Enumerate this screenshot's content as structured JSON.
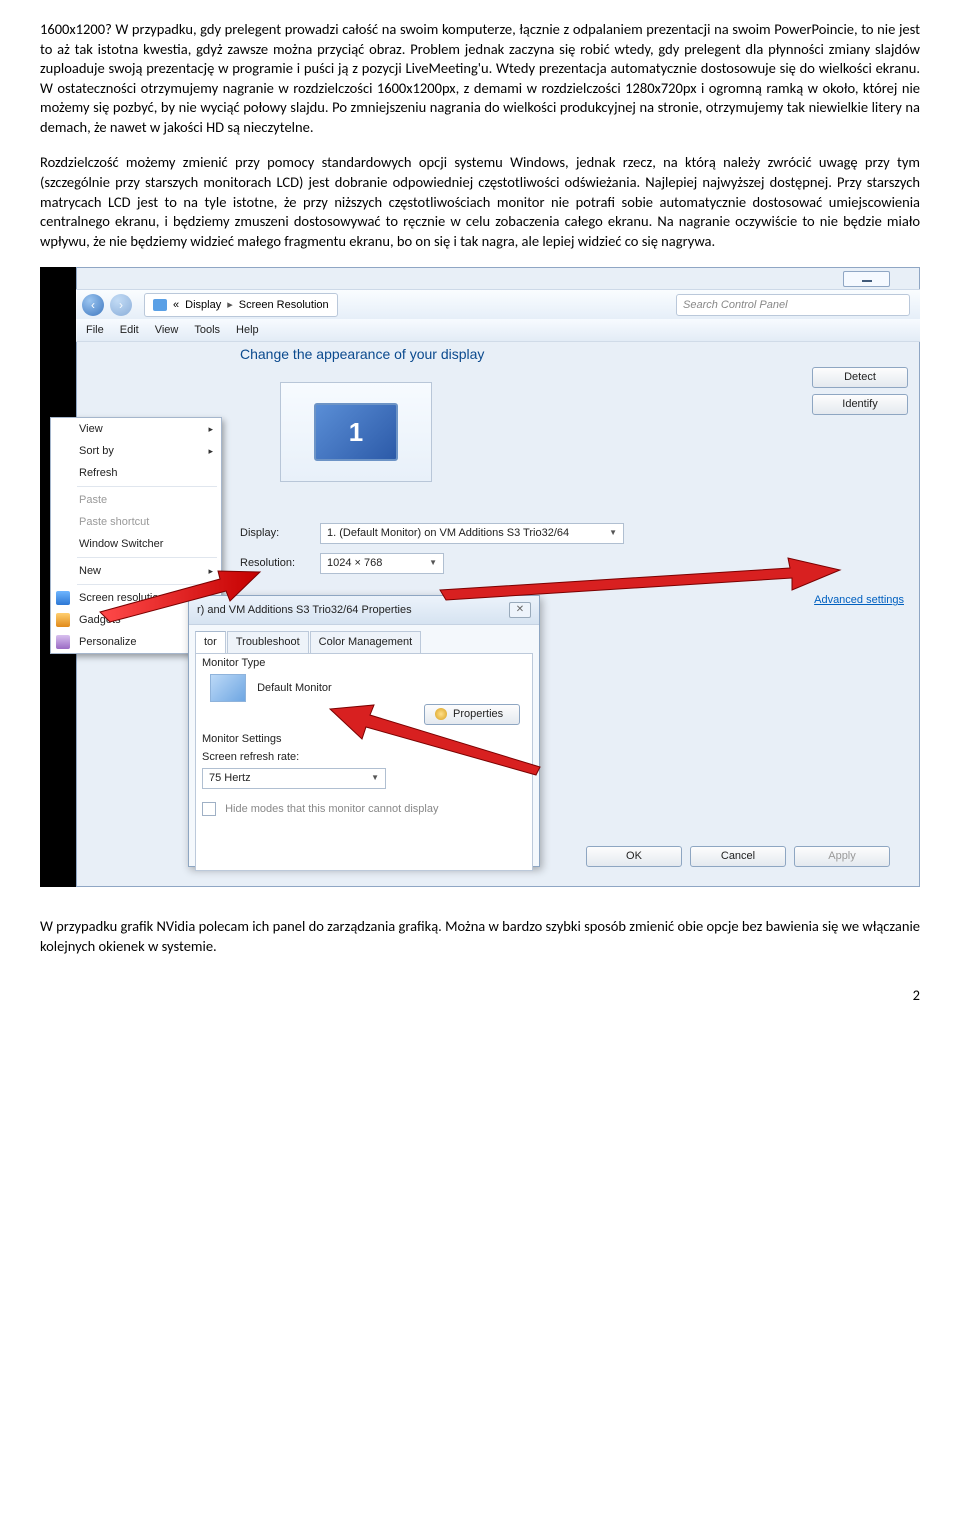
{
  "paragraphs": {
    "p1": "1600x1200? W przypadku, gdy prelegent prowadzi całość na swoim komputerze, łącznie z odpalaniem prezentacji na swoim PowerPoincie, to nie jest to aż tak istotna kwestia, gdyż zawsze można przyciąć obraz. Problem jednak zaczyna się robić wtedy, gdy prelegent dla płynności zmiany slajdów zuploaduje swoją prezentację w programie i puści ją z pozycji LiveMeeting'u. Wtedy prezentacja automatycznie dostosowuje się do wielkości ekranu. W ostateczności otrzymujemy nagranie w rozdzielczości 1600x1200px, z demami w rozdzielczości 1280x720px i ogromną ramką w około, której nie możemy się pozbyć, by nie wyciąć połowy slajdu. Po zmniejszeniu nagrania do wielkości produkcyjnej na stronie, otrzymujemy tak niewielkie litery na demach, że nawet w jakości HD są nieczytelne.",
    "p2": "Rozdzielczość możemy zmienić przy pomocy standardowych opcji systemu Windows, jednak rzecz, na którą należy zwrócić uwagę przy tym (szczególnie przy starszych monitorach LCD) jest dobranie odpowiedniej częstotliwości odświeżania. Najlepiej najwyższej dostępnej. Przy starszych matrycach LCD jest to na tyle istotne, że przy niższych częstotliwościach monitor nie potrafi sobie automatycznie dostosować umiejscowienia centralnego ekranu, i będziemy zmuszeni dostosowywać to ręcznie w celu zobaczenia całego ekranu. Na nagranie oczywiście to nie będzie miało wpływu, że nie będziemy widzieć małego fragmentu ekranu, bo on się i tak nagra, ale lepiej widzieć co się nagrywa.",
    "p3": "W przypadku grafik NVidia polecam ich panel do zarządzania grafiką. Można w bardzo szybki sposób zmienić obie opcje bez bawienia się we włączanie kolejnych okienek w systemie."
  },
  "screenshot": {
    "breadcrumb": {
      "sep1": "«",
      "part1": "Display",
      "arrow": "▸",
      "part2": "Screen Resolution"
    },
    "search_placeholder": "Search Control Panel",
    "menu": {
      "file": "File",
      "edit": "Edit",
      "view": "View",
      "tools": "Tools",
      "help": "Help"
    },
    "context_menu": {
      "view": "View",
      "sort": "Sort by",
      "refresh": "Refresh",
      "paste": "Paste",
      "paste_shortcut": "Paste shortcut",
      "window_switcher": "Window Switcher",
      "new": "New",
      "screen_resolution": "Screen resolution",
      "gadgets": "Gadgets",
      "personalize": "Personalize"
    },
    "content_title": "Change the appearance of your display",
    "monitor_number": "1",
    "detect": "Detect",
    "identify": "Identify",
    "form": {
      "display_label": "Display:",
      "display_value": "1. (Default Monitor) on VM Additions S3 Trio32/64",
      "resolution_label": "Resolution:",
      "resolution_value": "1024 × 768"
    },
    "advanced": "Advanced settings",
    "ok": "OK",
    "cancel": "Cancel",
    "apply": "Apply",
    "dialog": {
      "title": "r) and VM Additions S3 Trio32/64 Properties",
      "close": "✕",
      "tabs": {
        "tor": "tor",
        "troubleshoot": "Troubleshoot",
        "color": "Color Management"
      },
      "monitor_type": "Monitor Type",
      "default_monitor": "Default Monitor",
      "properties": "Properties",
      "monitor_settings": "Monitor Settings",
      "refresh_label": "Screen refresh rate:",
      "refresh_value": "75 Hertz",
      "hide_modes": "Hide modes that this monitor cannot display"
    }
  },
  "page_number": "2"
}
